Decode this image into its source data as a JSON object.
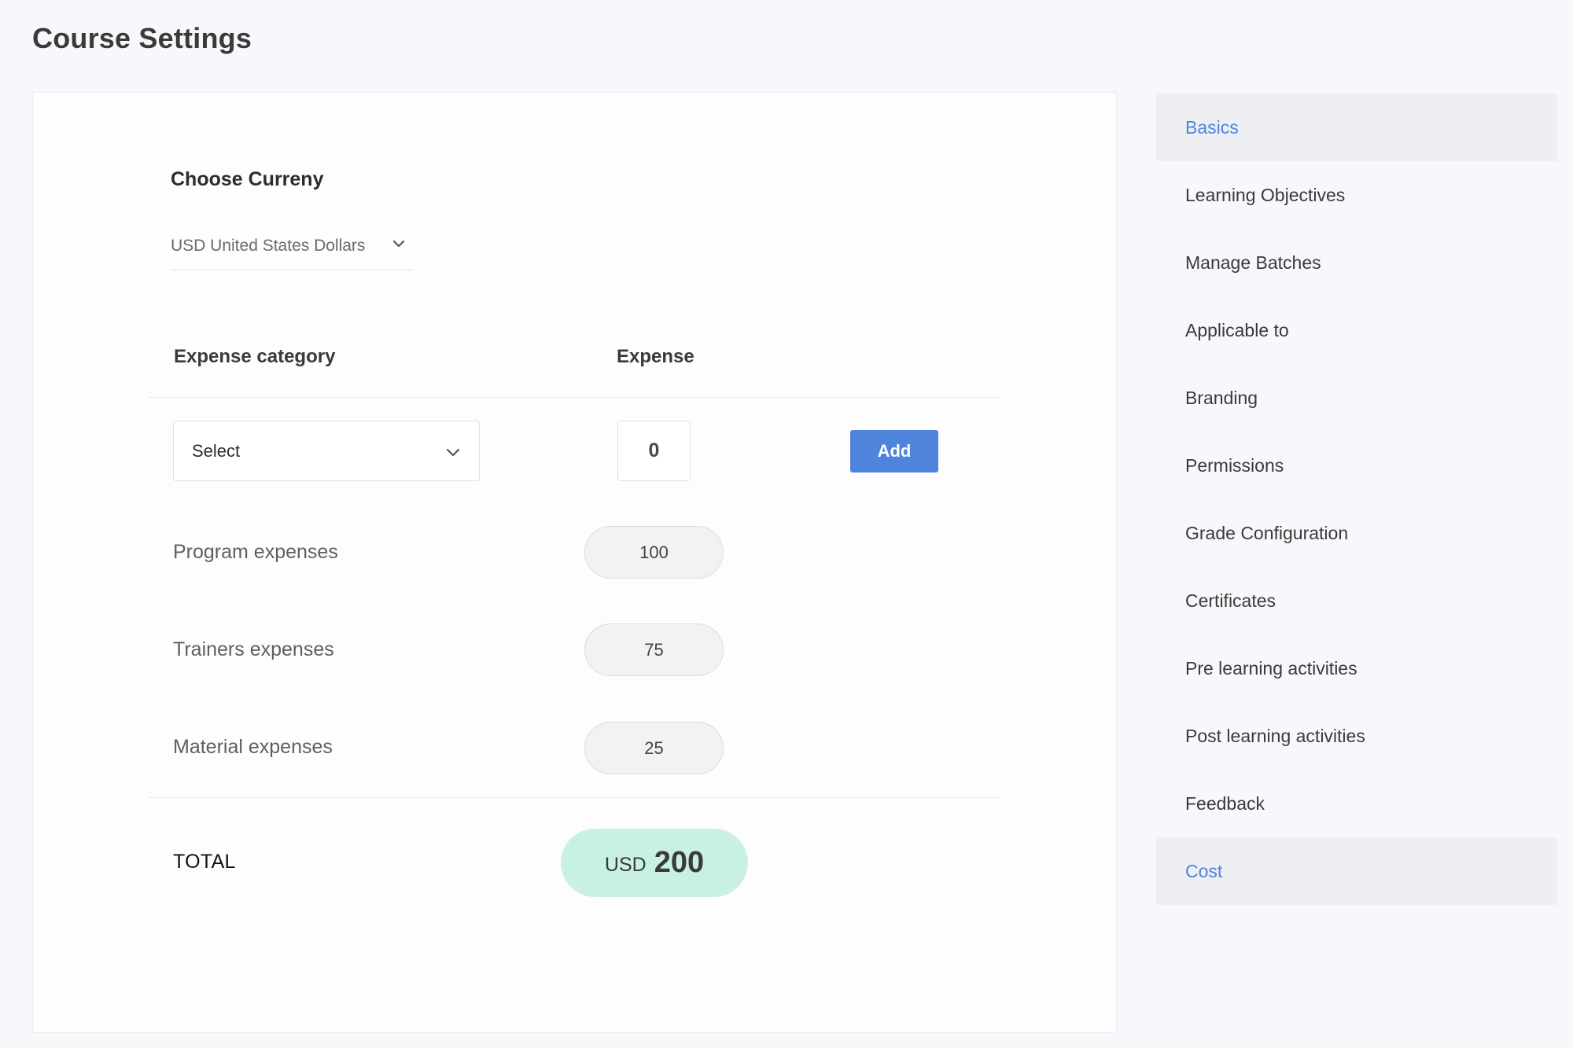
{
  "page": {
    "title": "Course Settings"
  },
  "currency": {
    "label": "Choose Curreny",
    "selected": "USD United States Dollars",
    "icon": "chevron-down-icon"
  },
  "table": {
    "headers": {
      "category": "Expense category",
      "expense": "Expense"
    },
    "new_row": {
      "category_value": "Select",
      "expense_value": "0",
      "add_label": "Add"
    },
    "rows": [
      {
        "label": "Program expenses",
        "value": "100"
      },
      {
        "label": "Trainers expenses",
        "value": "75"
      },
      {
        "label": "Material expenses",
        "value": "25"
      }
    ],
    "total": {
      "label": "TOTAL",
      "currency": "USD",
      "amount": "200"
    }
  },
  "sidebar": {
    "items": [
      {
        "label": "Basics",
        "active": true
      },
      {
        "label": "Learning Objectives",
        "active": false
      },
      {
        "label": "Manage Batches",
        "active": false
      },
      {
        "label": "Applicable to",
        "active": false
      },
      {
        "label": "Branding",
        "active": false
      },
      {
        "label": "Permissions",
        "active": false
      },
      {
        "label": "Grade Configuration",
        "active": false
      },
      {
        "label": "Certificates",
        "active": false
      },
      {
        "label": "Pre learning activities",
        "active": false
      },
      {
        "label": "Post learning activities",
        "active": false
      },
      {
        "label": "Feedback",
        "active": false
      },
      {
        "label": "Cost",
        "active": true
      }
    ]
  },
  "colors": {
    "accent": "#4f84dc",
    "total_bg": "#c9f1e2",
    "active_bg": "#eeeff3"
  }
}
